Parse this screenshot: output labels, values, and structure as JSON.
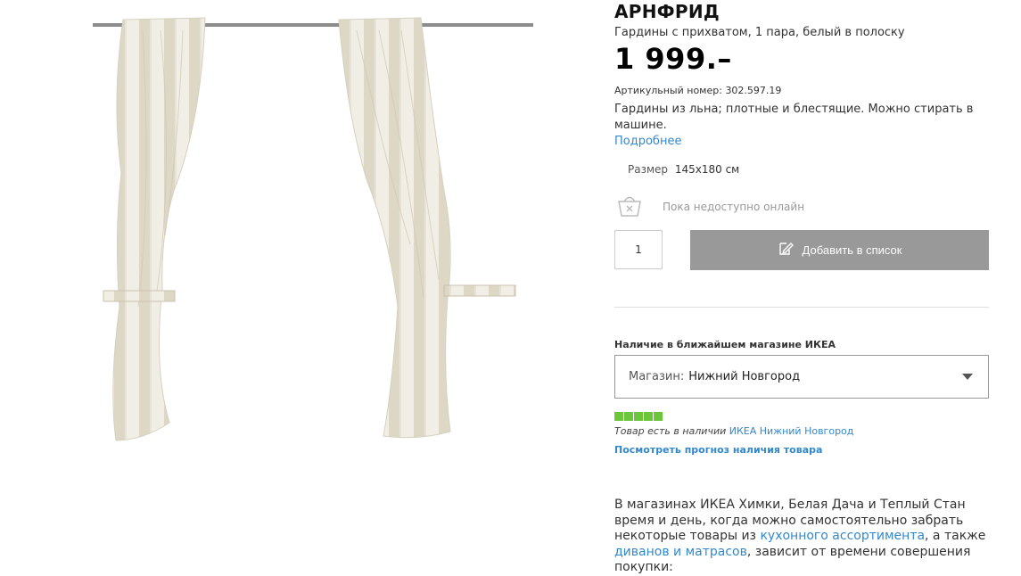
{
  "product": {
    "name": "АРНФРИД",
    "subtitle": "Гардины с прихватом, 1 пара, белый в полоску",
    "price": "1 999.–",
    "article_label": "Артикульный номер:",
    "article_number": "302.597.19",
    "description": "Гардины из льна; плотные и блестящие. Можно стирать в машине.",
    "more_link": "Подробнее",
    "size_label": "Размер",
    "size_value": "145x180 см",
    "image_icon": "curtain-image"
  },
  "purchase": {
    "basket_icon": "basket-crossed-icon",
    "unavailable_text": "Пока недоступно онлайн",
    "quantity": "1",
    "add_to_list_label": "Добавить в список",
    "add_icon": "edit-list-icon"
  },
  "availability": {
    "heading": "Наличие в ближайшем магазине ИКЕА",
    "store_label": "Магазин:",
    "store_value": "Нижний Новгород",
    "stock_level": 1.0,
    "stock_color": "#6cc63c",
    "stock_text": "Товар есть в наличии",
    "stock_store_link": "ИКЕА Нижний Новгород",
    "forecast_link": "Посмотреть прогноз наличия товара"
  },
  "promo": {
    "text_1": "В магазинах ИКЕА Химки, Белая Дача и Теплый Стан время и день, когда можно самостоятельно забрать некоторые товары из ",
    "link_1": "кухонного ассортимента",
    "text_2": ", а также ",
    "link_2": "диванов и матрасов",
    "text_3": ", зависит от времени совершения покупки:"
  },
  "colors": {
    "link": "#3388cc",
    "button_disabled": "#999999"
  }
}
